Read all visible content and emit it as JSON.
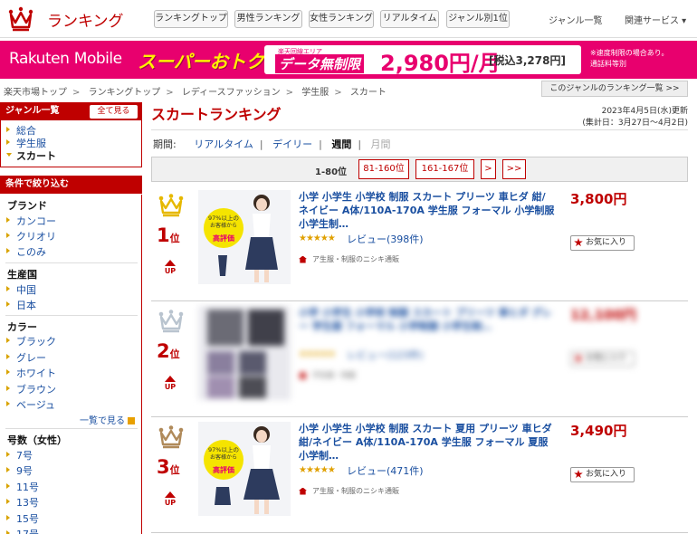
{
  "header": {
    "title": "ランキング",
    "tabs": [
      "ランキングトップ",
      "男性ランキング",
      "女性ランキング",
      "リアルタイム",
      "ジャンル別1位"
    ],
    "links": [
      "ジャンル一覧",
      "関連サービス ▾"
    ]
  },
  "banner": {
    "brand": "Rakuten",
    "brand2": "Mobile",
    "campaign": "スーパーおトク",
    "area_note": "楽天回線エリア",
    "data_label": "データ無制限",
    "price": "2,980円/月",
    "tax": "[税込3,278円]",
    "note": [
      "※速度制限の場合あり。",
      "通話料等別"
    ]
  },
  "breadcrumb": [
    "楽天市場トップ",
    "ランキングトップ",
    "レディースファッション",
    "学生服",
    "スカート"
  ],
  "genre_ranking_link": "このジャンルのランキング一覧 >>",
  "sidebar": {
    "genre_header": "ジャンル一覧",
    "all_view": "全て見る",
    "genres": [
      "総合",
      "学生服",
      "スカート"
    ],
    "filter_header": "条件で絞り込む",
    "brand_title": "ブランド",
    "brands": [
      "カンコー",
      "クリオリ",
      "このみ"
    ],
    "country_title": "生産国",
    "countries": [
      "中国",
      "日本"
    ],
    "color_title": "カラー",
    "colors": [
      "ブラック",
      "グレー",
      "ホワイト",
      "ブラウン",
      "ベージュ"
    ],
    "list_view": "一覧で見る",
    "size_title": "号数（女性）",
    "sizes": [
      "7号",
      "9号",
      "11号",
      "13号",
      "15号",
      "17号"
    ]
  },
  "main": {
    "title": "スカートランキング",
    "updated": "2023年4月5日(水)更新",
    "period_range": "(集計日：3月27日〜4月2日)",
    "period_label": "期間:",
    "periods": [
      "リアルタイム",
      "デイリー",
      "週間",
      "月間"
    ],
    "pager": {
      "current": "1-80位",
      "pages": [
        "81-160位",
        "161-167位",
        ">",
        ">>"
      ]
    },
    "items": [
      {
        "rank": "1",
        "rank_suffix": "位",
        "trend": "UP",
        "name": "小学 小学生 小学校 制服 スカート プリーツ 車ヒダ 紺/ネイビー A体/110A-170A 学生服 フォーマル 小学制服 小学生制…",
        "stars": "★★★★★",
        "reviews": "レビュー(398件)",
        "shop": "ア生服・制服のニシキ通販",
        "price": "3,800円",
        "fav": "お気に入り",
        "thumb_badge": [
          "97%以上の",
          "お客様から",
          "高評価"
        ]
      },
      {
        "rank": "2",
        "rank_suffix": "位",
        "trend": "UP",
        "name": "小学 小学生 小学校 制服 スカート プリーツ 車ヒダ グレー 学生服 フォーマル 小学制服 小学生制…",
        "stars": "★★★★★",
        "reviews": "レビュー(123件)",
        "shop": "学生服・制服",
        "price": "12,100円",
        "fav": "お気に入り",
        "thumb_badge": []
      },
      {
        "rank": "3",
        "rank_suffix": "位",
        "trend": "UP",
        "name": "小学 小学生 小学校 制服 スカート 夏用 プリーツ 車ヒダ 紺/ネイビー A体/110A-170A 学生服 フォーマル 夏服 小学制…",
        "stars": "★★★★★",
        "reviews": "レビュー(471件)",
        "shop": "ア生服・制服のニシキ通販",
        "price": "3,490円",
        "fav": "お気に入り",
        "thumb_badge": [
          "97%以上の",
          "お客様から",
          "高評価"
        ]
      }
    ]
  }
}
